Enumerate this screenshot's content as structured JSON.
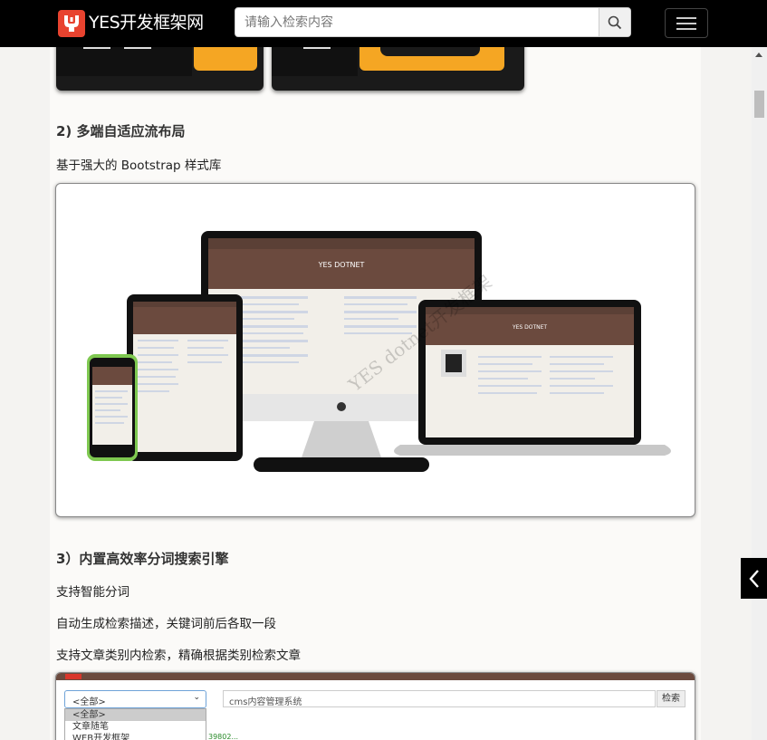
{
  "header": {
    "brand": "YES开发框架网",
    "search_placeholder": "请输入检索内容"
  },
  "section2": {
    "title": "2) 多端自适应流布局",
    "desc": "基于强大的 Bootstrap 样式库",
    "device_header_1": "YES DOTNET",
    "device_header_2": "YES DOTNET",
    "watermark": "YES dotnet开发框架"
  },
  "section3": {
    "title": "3）内置高效率分词搜索引擎",
    "features": [
      "支持智能分词",
      "自动生成检索描述，关键词前后各取一段",
      "支持文章类别内检索，精确根据类别检索文章"
    ]
  },
  "search_demo": {
    "category_selected": "<全部>",
    "category_options": [
      "<全部>",
      "文章随笔",
      "WEB开发框架"
    ],
    "query": "cms内容管理系统",
    "button": "检索",
    "link": "39802..."
  },
  "colors": {
    "topbar": "#000000",
    "accent": "#f5a623",
    "device_header": "#6b4a3e",
    "logo_red": "#d9362b"
  }
}
